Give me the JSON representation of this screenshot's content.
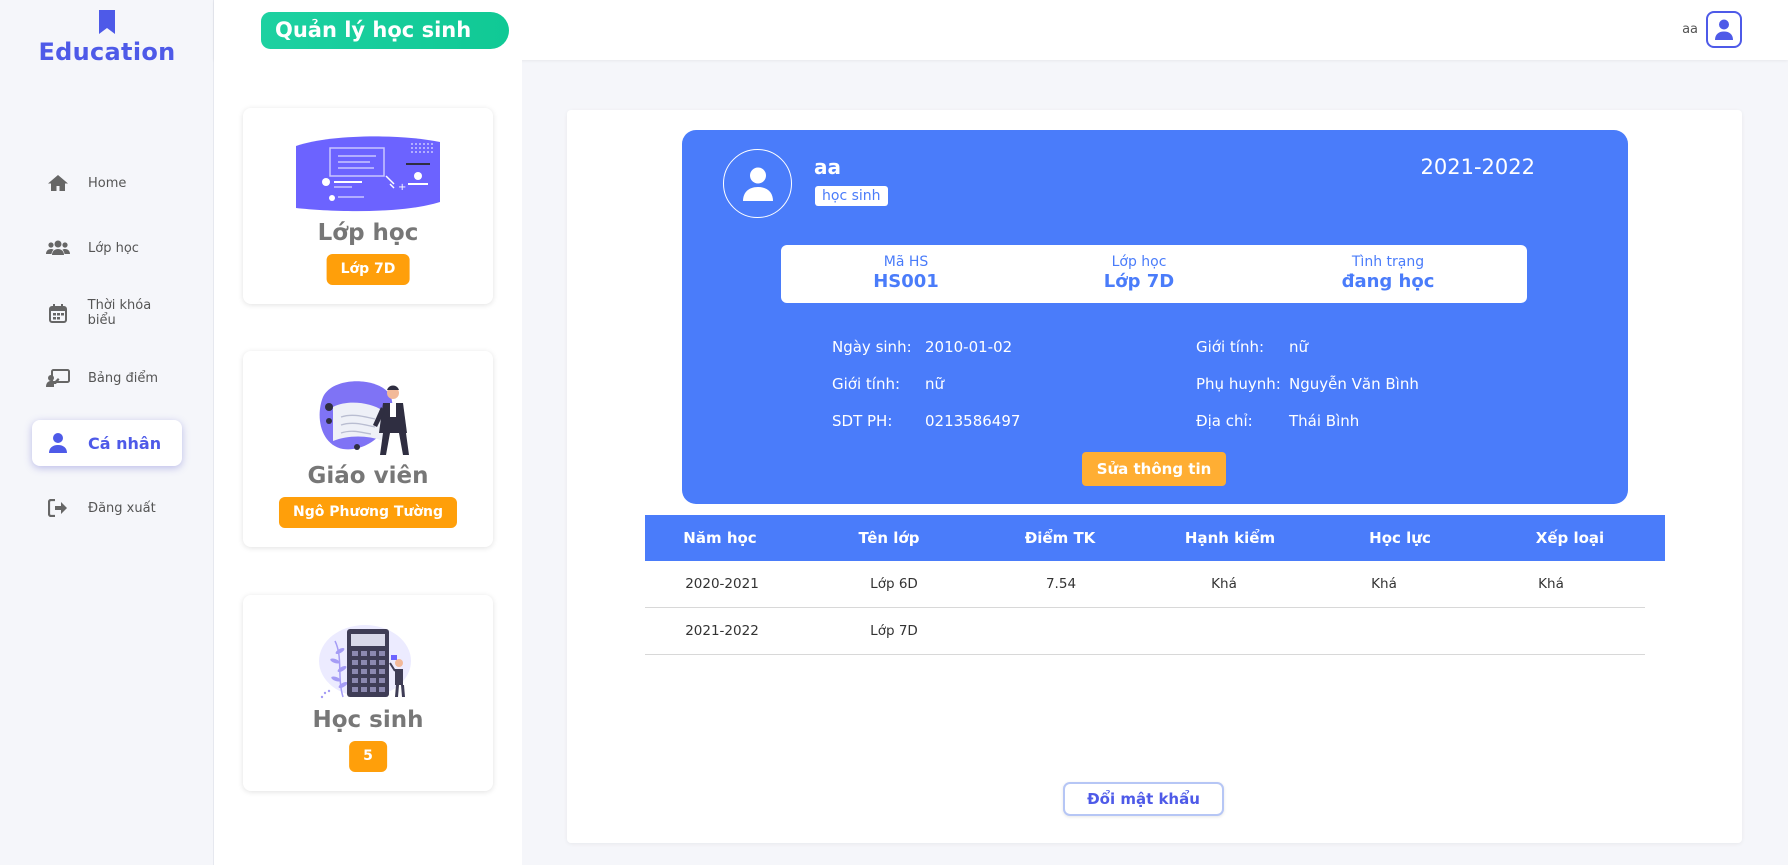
{
  "app": {
    "logo_text": "Education",
    "page_title": "Quản lý học sinh"
  },
  "user": {
    "name": "aa"
  },
  "sidebar": {
    "items": [
      {
        "label": "Home",
        "icon": "home-icon"
      },
      {
        "label": "Lớp học",
        "icon": "users-icon"
      },
      {
        "label": "Thời khóa biểu",
        "icon": "calendar-icon"
      },
      {
        "label": "Bảng điểm",
        "icon": "teacher-board-icon"
      },
      {
        "label": "Cá nhân",
        "icon": "person-icon",
        "active": true
      },
      {
        "label": "Đăng xuất",
        "icon": "sign-out-icon"
      }
    ]
  },
  "cards": {
    "class": {
      "title": "Lớp học",
      "badge": "Lớp 7D"
    },
    "teacher": {
      "title": "Giáo viên",
      "badge": "Ngô Phương Tường"
    },
    "students": {
      "title": "Học sinh",
      "badge": "5"
    }
  },
  "profile": {
    "name": "aa",
    "role": "học sinh",
    "year": "2021-2022",
    "info": [
      {
        "label": "Mã HS",
        "value": "HS001"
      },
      {
        "label": "Lớp học",
        "value": "Lớp 7D"
      },
      {
        "label": "Tình trạng",
        "value": "đang học"
      }
    ],
    "details_left": [
      {
        "label": "Ngày sinh:",
        "value": "2010-01-02"
      },
      {
        "label": "Giới tính:",
        "value": "nữ"
      },
      {
        "label": "SDT PH:",
        "value": "0213586497"
      }
    ],
    "details_right": [
      {
        "label": "Giới tính:",
        "value": "nữ"
      },
      {
        "label": "Phụ huynh:",
        "value": "Nguyễn Văn Bình"
      },
      {
        "label": "Địa chỉ:",
        "value": "Thái Bình"
      }
    ],
    "edit_button": "Sửa thông tin"
  },
  "grades_table": {
    "headers": [
      "Năm học",
      "Tên lớp",
      "Điểm TK",
      "Hạnh kiểm",
      "Học lực",
      "Xếp loại"
    ],
    "rows": [
      [
        "2020-2021",
        "Lớp 6D",
        "7.54",
        "Khá",
        "Khá",
        "Khá"
      ],
      [
        "2021-2022",
        "Lớp 7D",
        "",
        "",
        "",
        ""
      ]
    ]
  },
  "change_password_button": "Đổi mật khẩu",
  "colors": {
    "primary": "#4e5ae8",
    "card_blue": "#4a7cfa",
    "accent_orange": "#ff9f0a",
    "title_green": "#1dd1a1"
  }
}
